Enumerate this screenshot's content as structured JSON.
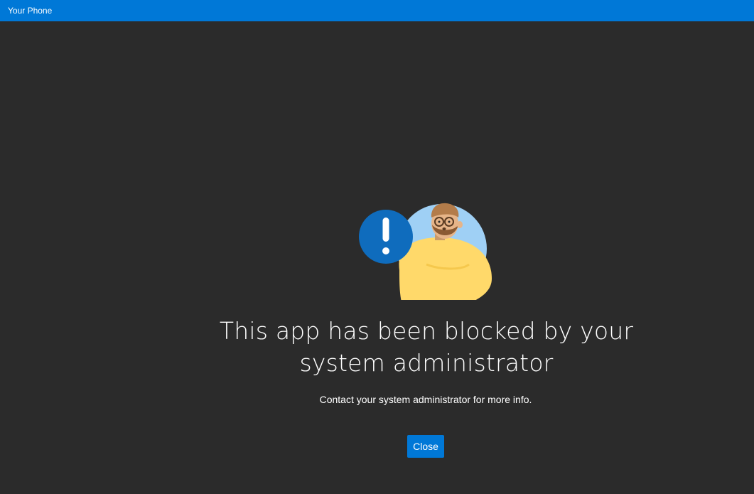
{
  "window": {
    "title": "Your Phone"
  },
  "main": {
    "headline": "This app has been blocked by your system administrator",
    "message": "Contact your system administrator for more info.",
    "close_label": "Close"
  },
  "icons": {
    "alert": "exclamation-icon",
    "illustration": "person-illustration"
  },
  "colors": {
    "titlebar": "#0078d7",
    "background": "#2b2b2b",
    "accent": "#0078d7",
    "text": "#ffffff"
  }
}
